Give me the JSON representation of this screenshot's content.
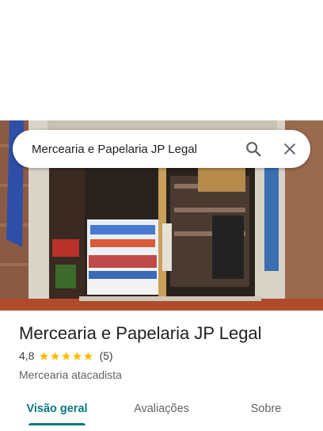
{
  "search": {
    "query": "Mercearia e Papelaria JP Legal"
  },
  "icons": {
    "search": "search-icon",
    "close": "close-icon",
    "star": "star-icon"
  },
  "place": {
    "name": "Mercearia e Papelaria JP Legal",
    "rating": "4,8",
    "stars": 5,
    "reviews": "(5)",
    "category": "Mercearia atacadista"
  },
  "tabs": [
    {
      "label": "Visão geral",
      "active": true
    },
    {
      "label": "Avaliações",
      "active": false
    },
    {
      "label": "Sobre",
      "active": false
    }
  ],
  "colors": {
    "accent": "#0b7a80",
    "star": "#fbbc04"
  }
}
